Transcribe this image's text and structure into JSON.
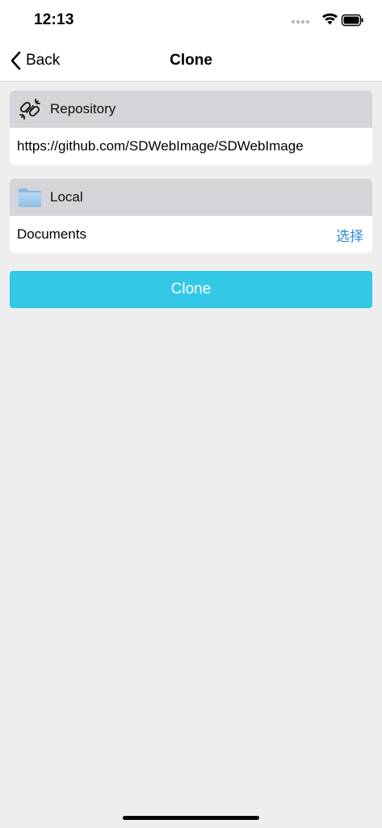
{
  "status_bar": {
    "time": "12:13",
    "icons": [
      "signal-dots-icon",
      "wifi-icon",
      "battery-icon"
    ]
  },
  "nav": {
    "back_label": "Back",
    "title": "Clone"
  },
  "repository": {
    "header_label": "Repository",
    "icon": "link-icon",
    "url": "https://github.com/SDWebImage/SDWebImage"
  },
  "local": {
    "header_label": "Local",
    "icon": "folder-icon",
    "path": "Documents",
    "choose_label": "选择"
  },
  "actions": {
    "clone_label": "Clone"
  },
  "colors": {
    "accent": "#33c8e6",
    "link": "#2f8ad8",
    "header_bg": "#d4d4d9",
    "page_bg": "#eeeeee"
  }
}
